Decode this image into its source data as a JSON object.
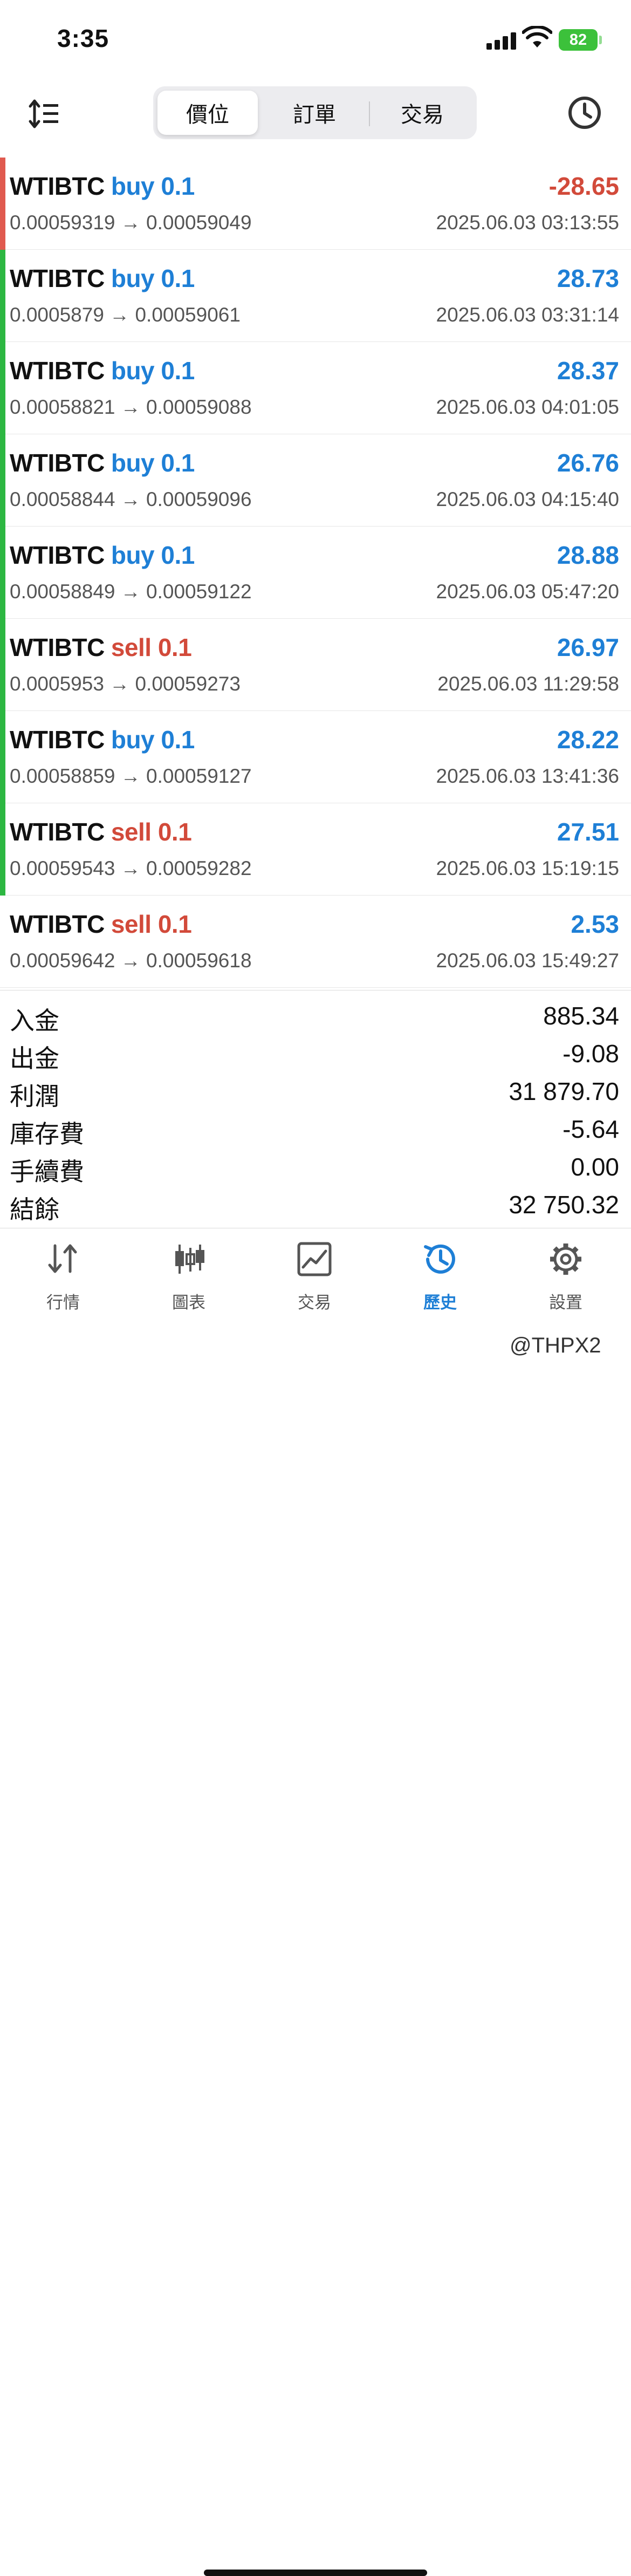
{
  "status_bar": {
    "time": "3:35",
    "battery": "82"
  },
  "toolbar": {
    "tabs": [
      {
        "label": "價位"
      },
      {
        "label": "訂單"
      },
      {
        "label": "交易"
      }
    ],
    "active_tab": 0
  },
  "trades": [
    {
      "symbol": "WTIBTC",
      "side": "buy 0.1",
      "profit": "-28.65",
      "prices": "0.00059319 → 0.00059049",
      "time": "2025.06.03 03:13:55"
    },
    {
      "symbol": "WTIBTC",
      "side": "buy 0.1",
      "profit": "28.73",
      "prices": "0.0005879 → 0.00059061",
      "time": "2025.06.03 03:31:14"
    },
    {
      "symbol": "WTIBTC",
      "side": "buy 0.1",
      "profit": "28.37",
      "prices": "0.00058821 → 0.00059088",
      "time": "2025.06.03 04:01:05"
    },
    {
      "symbol": "WTIBTC",
      "side": "buy 0.1",
      "profit": "26.76",
      "prices": "0.00058844 → 0.00059096",
      "time": "2025.06.03 04:15:40"
    },
    {
      "symbol": "WTIBTC",
      "side": "buy 0.1",
      "profit": "28.88",
      "prices": "0.00058849 → 0.00059122",
      "time": "2025.06.03 05:47:20"
    },
    {
      "symbol": "WTIBTC",
      "side": "sell 0.1",
      "profit": "26.97",
      "prices": "0.0005953 → 0.00059273",
      "time": "2025.06.03 11:29:58"
    },
    {
      "symbol": "WTIBTC",
      "side": "buy 0.1",
      "profit": "28.22",
      "prices": "0.00058859 → 0.00059127",
      "time": "2025.06.03 13:41:36"
    },
    {
      "symbol": "WTIBTC",
      "side": "sell 0.1",
      "profit": "27.51",
      "prices": "0.00059543 → 0.00059282",
      "time": "2025.06.03 15:19:15"
    },
    {
      "symbol": "WTIBTC",
      "side": "sell 0.1",
      "profit": "2.53",
      "prices": "0.00059642 → 0.00059618",
      "time": "2025.06.03 15:49:27"
    }
  ],
  "summary": [
    {
      "label": "入金",
      "value": "885.34"
    },
    {
      "label": "出金",
      "value": "-9.08"
    },
    {
      "label": "利潤",
      "value": "31 879.70"
    },
    {
      "label": "庫存費",
      "value": "-5.64"
    },
    {
      "label": "手續費",
      "value": "0.00"
    },
    {
      "label": "結餘",
      "value": "32 750.32"
    }
  ],
  "tabbar": [
    {
      "label": "行情",
      "icon": "quotes-icon"
    },
    {
      "label": "圖表",
      "icon": "chart-candles-icon"
    },
    {
      "label": "交易",
      "icon": "trade-chart-icon"
    },
    {
      "label": "歷史",
      "icon": "history-icon"
    },
    {
      "label": "設置",
      "icon": "settings-gear-icon"
    }
  ],
  "active_tabbar": 3,
  "watermark": "@THPX2",
  "colors": {
    "buy": "#1e7fd6",
    "sell": "#d24a3a",
    "profit_pos": "#1e7fd6",
    "profit_neg": "#d24a3a",
    "bar_green": "#2db742",
    "bar_red": "#e05a4f"
  }
}
